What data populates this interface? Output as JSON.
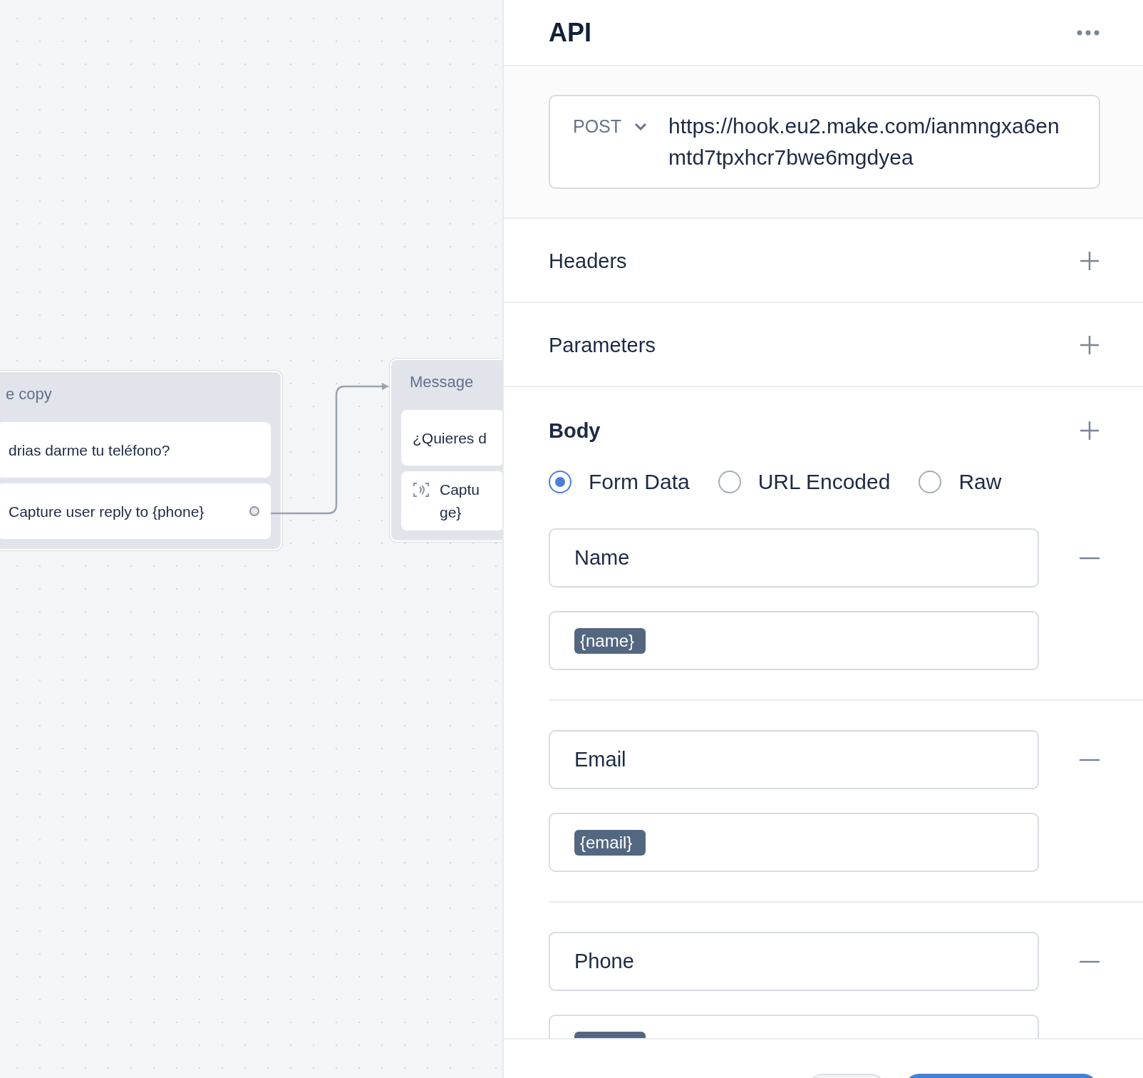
{
  "canvas": {
    "nodes": [
      {
        "title": "e copy",
        "items": [
          {
            "kind": "text",
            "lines": [
              "drias darme tu teléfono?"
            ]
          },
          {
            "kind": "port",
            "lines": [
              "Capture user reply to {phone}"
            ]
          }
        ]
      },
      {
        "title": "Message",
        "items": [
          {
            "kind": "text",
            "lines": [
              "¿Quieres d"
            ]
          },
          {
            "kind": "capture",
            "lines": [
              "Captu",
              "ge}"
            ]
          }
        ]
      }
    ]
  },
  "panel": {
    "title": "API",
    "method": "POST",
    "url": "https://hook.eu2.make.com/ianmngxa6enmtd7tpxhcr7bwe6mgdyea",
    "sections": [
      {
        "label": "Headers",
        "expanded": false
      },
      {
        "label": "Parameters",
        "expanded": false
      },
      {
        "label": "Body",
        "expanded": true
      }
    ],
    "body_types": [
      {
        "label": "Form Data",
        "selected": true
      },
      {
        "label": "URL Encoded",
        "selected": false
      },
      {
        "label": "Raw",
        "selected": false
      }
    ],
    "fields": [
      {
        "key": "Name",
        "value": "{name}"
      },
      {
        "key": "Email",
        "value": "{email}"
      },
      {
        "key": "Phone",
        "value_hidden": true
      }
    ],
    "footer": {
      "buttons": [
        {
          "kind": "secondary"
        },
        {
          "kind": "primary"
        }
      ]
    }
  }
}
